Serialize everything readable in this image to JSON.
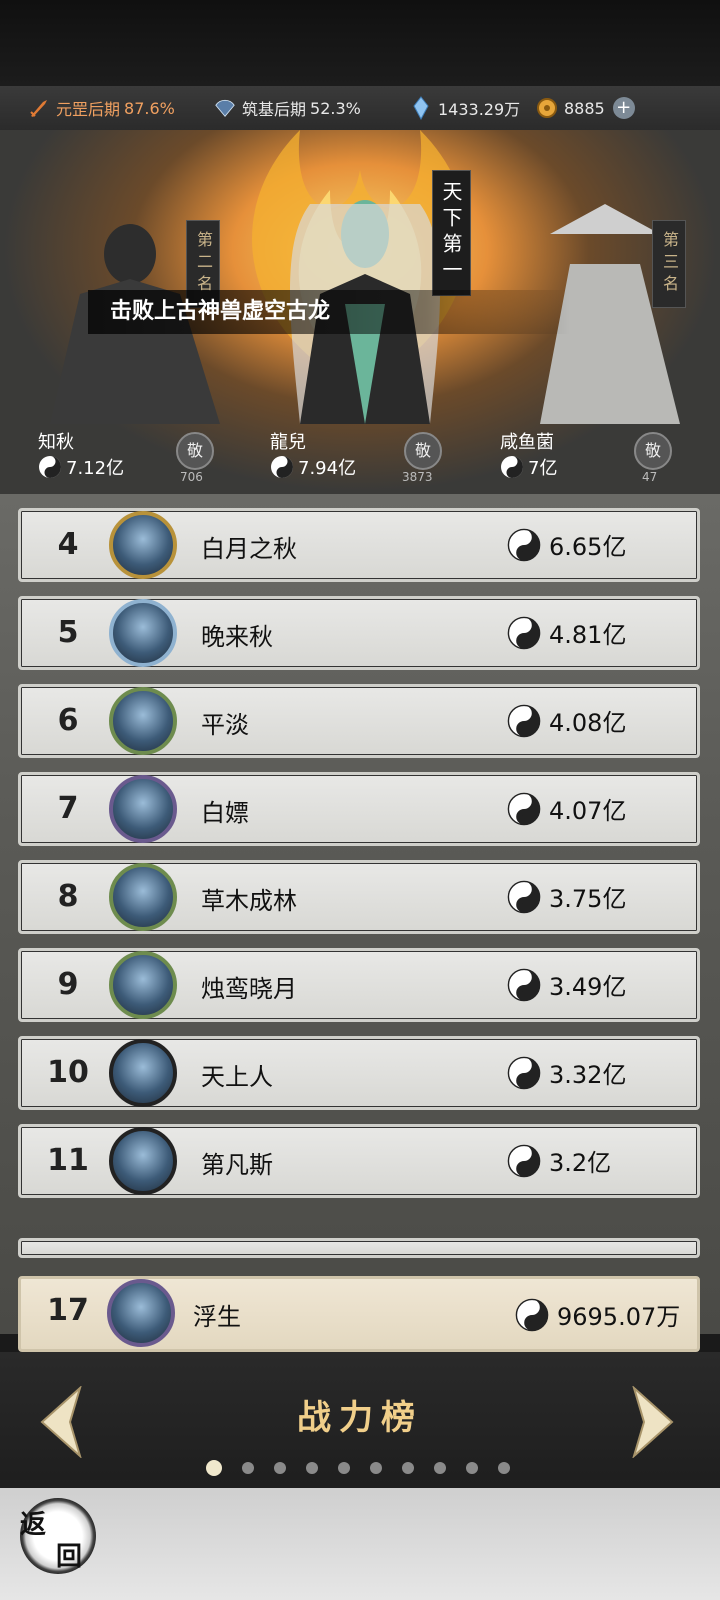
{
  "resources": {
    "realm1_label": "元罡后期",
    "realm1_pct": "87.6%",
    "realm2_label": "筑基后期",
    "realm2_pct": "52.3%",
    "spirit_stones": "1433.29万",
    "coins": "8885"
  },
  "hero": {
    "banner": "击败上古神兽虚空古龙",
    "rank1_tag": "天下第一",
    "rank2_tag": "第二名",
    "rank3_tag": "第三名",
    "top3": [
      {
        "name": "知秋",
        "power": "7.12亿",
        "bow": "敬",
        "bow_count": "706"
      },
      {
        "name": "龍兒",
        "power": "7.94亿",
        "bow": "敬",
        "bow_count": "3873"
      },
      {
        "name": "咸鱼菌",
        "power": "7亿",
        "bow": "敬",
        "bow_count": "47"
      }
    ]
  },
  "ranking": [
    {
      "rank": "4",
      "name": "白月之秋",
      "power": "6.65亿"
    },
    {
      "rank": "5",
      "name": "晚来秋",
      "power": "4.81亿"
    },
    {
      "rank": "6",
      "name": "平淡",
      "power": "4.08亿"
    },
    {
      "rank": "7",
      "name": "白嫖",
      "power": "4.07亿"
    },
    {
      "rank": "8",
      "name": "草木成林",
      "power": "3.75亿"
    },
    {
      "rank": "9",
      "name": "烛鸾晓月",
      "power": "3.49亿"
    },
    {
      "rank": "10",
      "name": "天上人",
      "power": "3.32亿"
    },
    {
      "rank": "11",
      "name": "第凡斯",
      "power": "3.2亿"
    }
  ],
  "self": {
    "rank": "17",
    "name": "浮生",
    "power": "9695.07万"
  },
  "nav": {
    "title": "战力榜",
    "back_top": "返",
    "back_bottom": "回"
  },
  "colors": {
    "accent": "#f1cf8a",
    "realm": "#f0a060"
  }
}
